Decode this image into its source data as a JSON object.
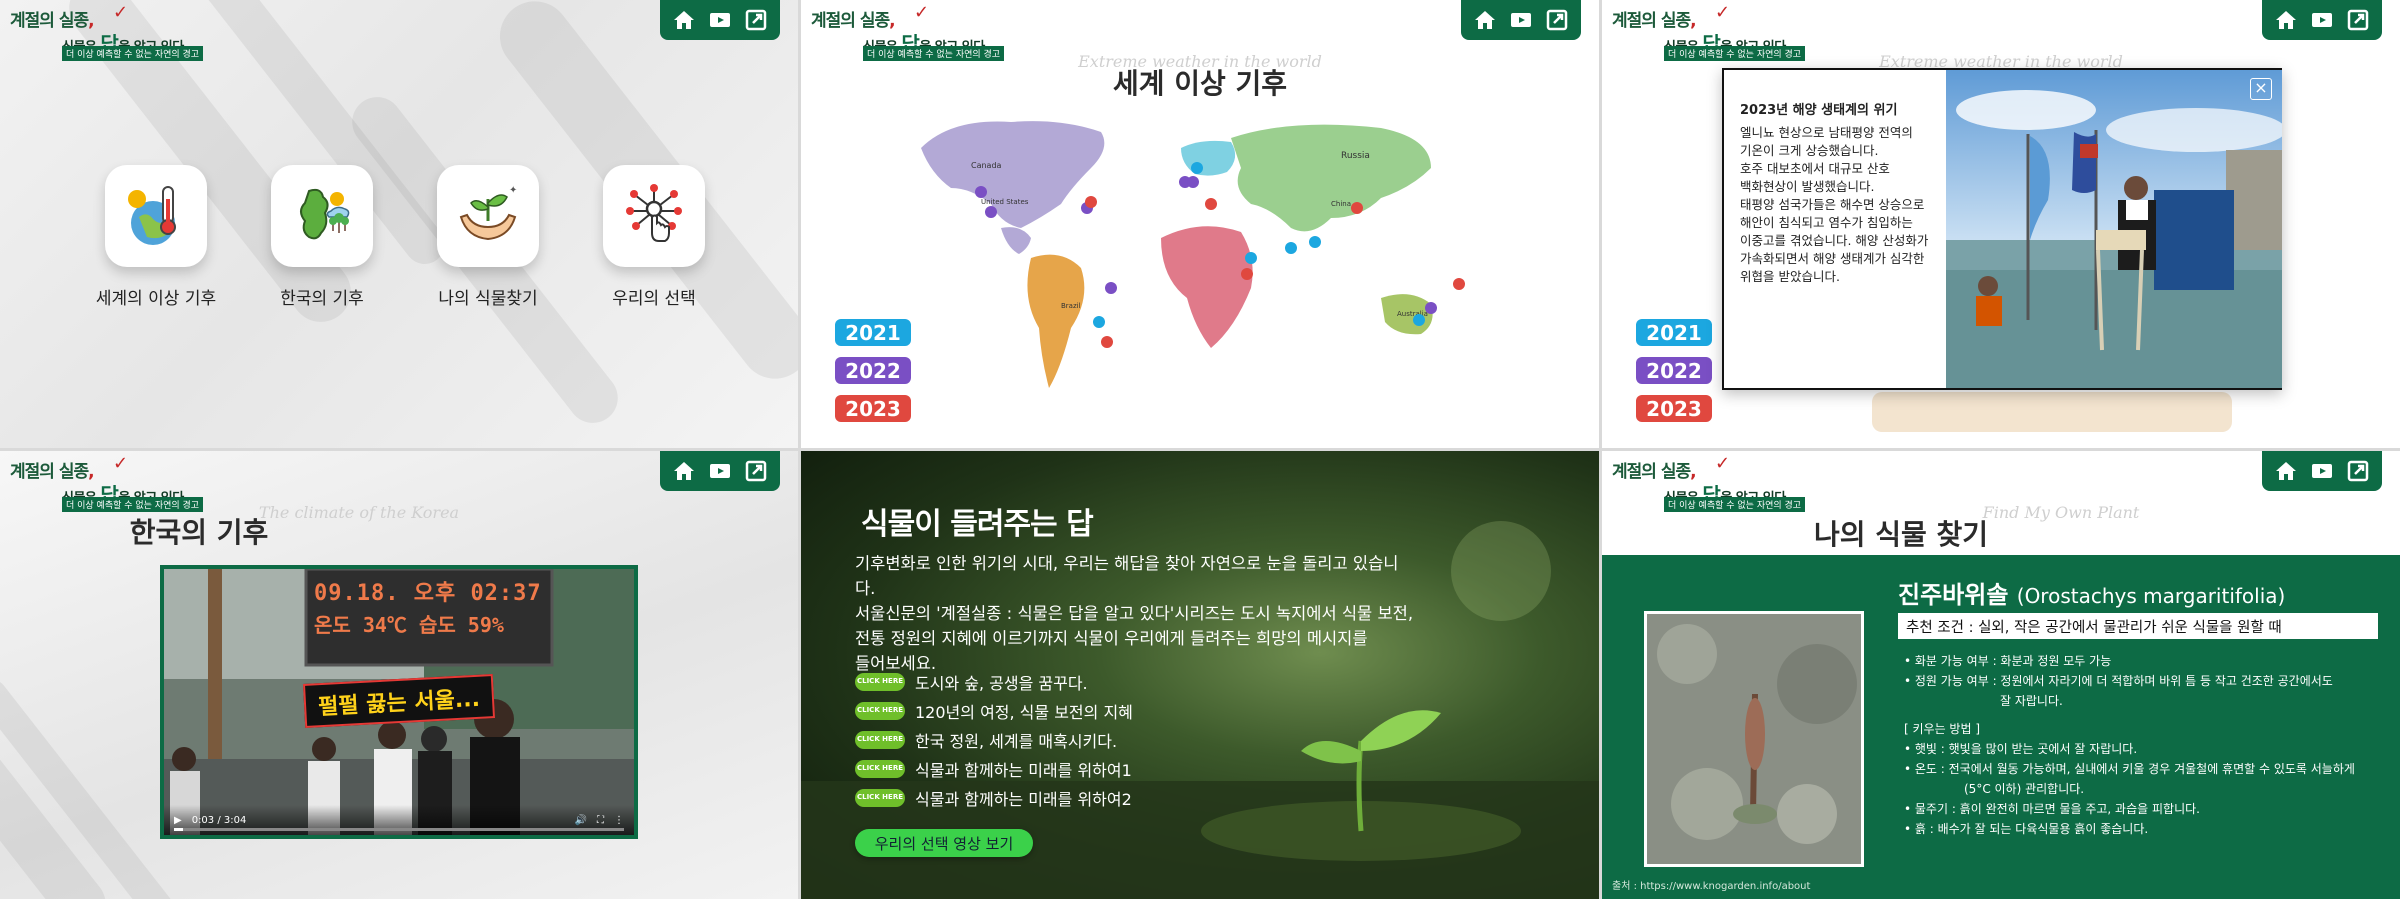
{
  "logo": {
    "line1_a": "계절의 실종",
    "line1_b": ",",
    "line2_a": "식물은 ",
    "line2_big": "답",
    "line2_b": "을 알고 있다.",
    "tagline": "더 이상 예측할 수 없는 자연의 경고"
  },
  "nav": {
    "home_icon": "home-icon",
    "play_icon": "play-icon",
    "share_icon": "external-link-icon"
  },
  "home": {
    "items": [
      {
        "label": "세계의 이상 기후",
        "icon": "thermometer-globe-icon"
      },
      {
        "label": "한국의 기후",
        "icon": "korea-map-icon"
      },
      {
        "label": "나의 식물찾기",
        "icon": "sprout-hands-icon"
      },
      {
        "label": "우리의 선택",
        "icon": "network-hand-icon"
      }
    ]
  },
  "world": {
    "title": "세계 이상 기후",
    "script": "Extreme weather in the world",
    "years": [
      {
        "label": "2021",
        "color": "#1ca7e0"
      },
      {
        "label": "2022",
        "color": "#7a4fc4"
      },
      {
        "label": "2023",
        "color": "#e0483f"
      }
    ],
    "map_labels": [
      "Russia",
      "Canada",
      "United States",
      "China",
      "Brazil",
      "Australia"
    ]
  },
  "popup": {
    "title": "2023년 해양 생태계의 위기",
    "lines": [
      "엘니뇨 현상으로 남태평양 전역의",
      "기온이 크게 상승했습니다.",
      "호주 대보초에서 대규모 산호",
      "백화현상이 발생했습니다.",
      "태평양 섬국가들은 해수면 상승으로",
      "해안이 침식되고 염수가 침입하는",
      "이중고를 겪었습니다. 해양 산성화가",
      "가속화되면서 해양 생태계가 심각한",
      "위협을 받았습니다."
    ],
    "close": "×"
  },
  "korea": {
    "title": "한국의 기후",
    "script": "The climate of the Korea",
    "sign_line1": "09.18. 오후 02:37",
    "sign_line2": "온도 34℃ 습도 59%",
    "caption": "펄펄 끓는 서울...",
    "video_time": "0:03 / 3:04"
  },
  "answer": {
    "title": "식물이 들려주는 답",
    "body": [
      "기후변화로 인한 위기의 시대, 우리는 해답을 찾아 자연으로 눈을 돌리고 있습니다.",
      "서울신문의 '계절실종 : 식물은 답을 알고 있다'시리즈는 도시 녹지에서 식물 보전,",
      "전통 정원의 지혜에 이르기까지 식물이 우리에게 들려주는 희망의 메시지를",
      "들어보세요."
    ],
    "click_here": "CLICK HERE",
    "items": [
      "도시와 숲, 공생을 꿈꾸다.",
      "120년의 여정, 식물 보전의 지혜",
      "한국 정원, 세계를 매혹시키다.",
      "식물과 함께하는 미래를 위하여1",
      "식물과 함께하는 미래를 위하여2"
    ],
    "button": "우리의 선택 영상 보기"
  },
  "plant": {
    "title": "나의 식물 찾기",
    "script": "Find My Own Plant",
    "name_ko": "진주바위솔",
    "name_sci": "(Orostachys margaritifolia)",
    "recommend": "추천 조건 : 실외, 작은 공간에서 물관리가 쉬운 식물을 원할 때",
    "info": [
      "• 화분 가능 여부 : 화분과 정원 모두 가능",
      "• 정원 가능 여부 : 정원에서 자라기에 더 적합하며 바위 틈 등 작고 건조한 공간에서도",
      "잘 자랍니다.",
      "[ 키우는 방법 ]",
      "• 햇빛 : 햇빛을 많이 받는 곳에서 잘 자랍니다.",
      "• 온도 : 전국에서 월동 가능하며, 실내에서 키울 경우 겨울철에 휴면할 수 있도록 서늘하게",
      "(5°C 이하) 관리합니다.",
      "• 물주기 : 흙이 완전히 마르면 물을 주고, 과습을 피합니다.",
      "• 흙 : 배수가 잘 되는 다육식물용 흙이 좋습니다."
    ],
    "source": "출처 : https://www.knogarden.info/about"
  }
}
